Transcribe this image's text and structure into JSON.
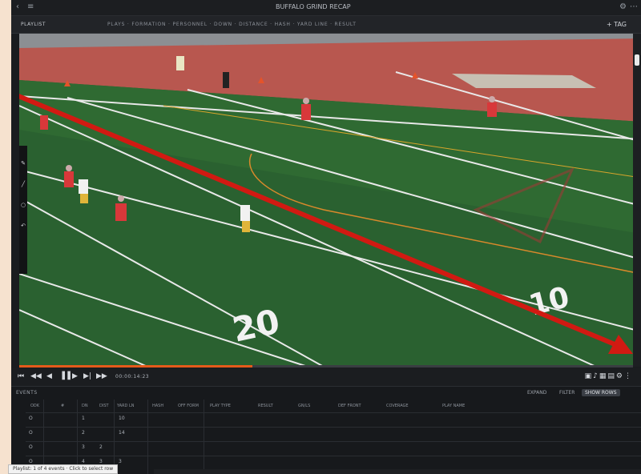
{
  "window": {
    "title": "BUFFALO GRIND RECAP"
  },
  "toolbar": {
    "left_label": "PLAYLIST",
    "crumbs": "PLAYS · FORMATION · PERSONNEL · DOWN · DISTANCE · HASH · YARD LINE · RESULT",
    "right_label": "+ TAG"
  },
  "field": {
    "yard_20": "20",
    "yard_10": "10"
  },
  "video_colors": {
    "turf": "#2f6a32",
    "track": "#b8574f",
    "arrow": "#d11a12"
  },
  "transport": {
    "timecode": "00:00:14:23",
    "progress": 0.38,
    "buttons": [
      "◀◀",
      "◀",
      "▐▐",
      "▶",
      "▶|",
      "▶▶"
    ]
  },
  "panel": {
    "name": "EVENTS",
    "tabs": [
      "EXPAND",
      "FILTER",
      "SHOW ROWS"
    ],
    "columns": [
      "ODK",
      "#",
      "DN",
      "DIST",
      "YARD LN",
      "HASH",
      "OFF FORM",
      "PLAY TYPE",
      "RESULT",
      "GN/LS",
      "DEF FRONT",
      "COVERAGE",
      "PLAY NAME"
    ],
    "rows": [
      {
        "odk": "O",
        "num": "1",
        "dn": "",
        "dist": "10"
      },
      {
        "odk": "O",
        "num": "2",
        "dn": "",
        "dist": "14"
      },
      {
        "odk": "O",
        "num": "3",
        "dn": "2",
        "dist": ""
      },
      {
        "odk": "O",
        "num": "4",
        "dn": "3",
        "dist": "3"
      }
    ]
  },
  "tooltip": "Playlist: 1 of 4 events · Click to select row"
}
